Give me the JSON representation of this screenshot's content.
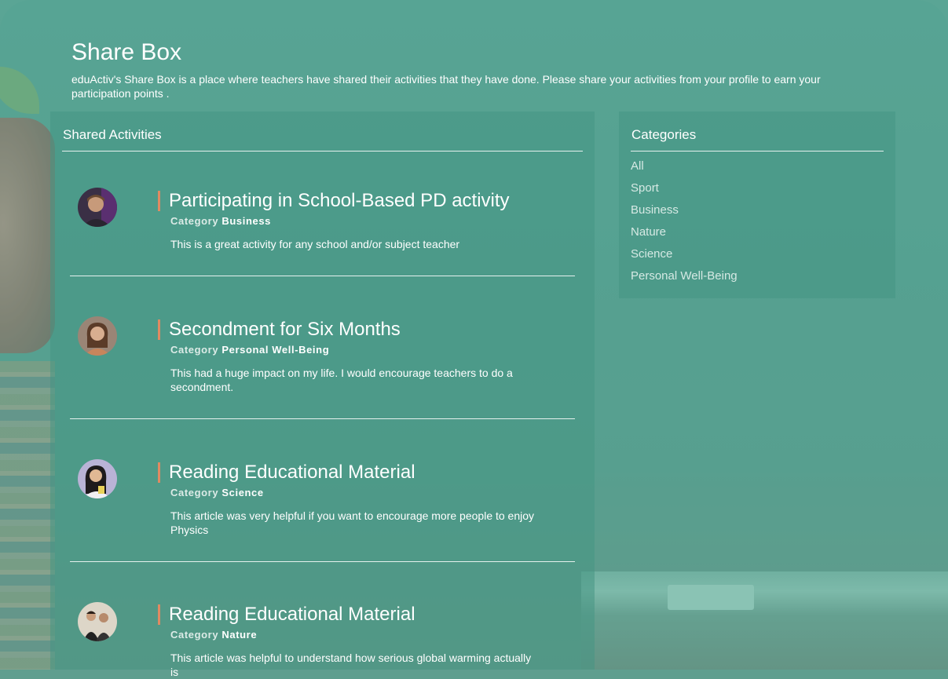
{
  "header": {
    "title": "Share Box",
    "intro": "eduActiv's Share Box is a place where teachers have shared their activities that they have done. Please share your activities from your profile to earn your participation points ."
  },
  "activities_panel": {
    "title": "Shared Activities",
    "category_label": "Category",
    "items": [
      {
        "title": "Participating in School-Based PD activity",
        "category": "Business",
        "description": "This is a great activity for any school and/or subject teacher",
        "avatar_icon": "avatar-man-icon"
      },
      {
        "title": "Secondment for Six Months",
        "category": "Personal Well-Being",
        "description": "This had a huge impact on my life. I would encourage teachers to do a secondment.",
        "avatar_icon": "avatar-woman-icon"
      },
      {
        "title": "Reading Educational Material",
        "category": "Science",
        "description": "This article was very helpful if you want to encourage more people to enjoy Physics",
        "avatar_icon": "avatar-woman-icon"
      },
      {
        "title": "Reading Educational Material",
        "category": "Nature",
        "description": "This article was helpful to understand how serious global warming actually is",
        "avatar_icon": "avatar-group-icon"
      }
    ]
  },
  "categories_panel": {
    "title": "Categories",
    "items": [
      "All",
      "Sport",
      "Business",
      "Nature",
      "Science",
      "Personal Well-Being"
    ]
  },
  "colors": {
    "accent": "#e08a62",
    "panel": "#4f9c8a",
    "background": "#5aa595"
  }
}
